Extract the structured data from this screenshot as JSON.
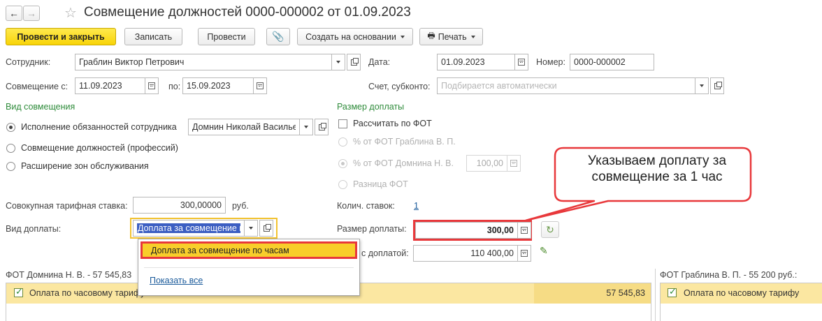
{
  "header": {
    "title": "Совмещение должностей 0000-000002 от 01.09.2023"
  },
  "toolbar": {
    "post_close": "Провести и закрыть",
    "save": "Записать",
    "post": "Провести",
    "create_based": "Создать на основании",
    "print": "Печать"
  },
  "form": {
    "employee_label": "Сотрудник:",
    "employee_value": "Граблин Виктор Петрович",
    "date_label": "Дата:",
    "date_value": "01.09.2023",
    "number_label": "Номер:",
    "number_value": "0000-000002",
    "from_label": "Совмещение с:",
    "from_value": "11.09.2023",
    "to_label": "по:",
    "to_value": "15.09.2023",
    "account_label": "Счет, субконто:",
    "account_placeholder": "Подбирается автоматически"
  },
  "combination": {
    "title": "Вид совмещения",
    "options": [
      "Исполнение обязанностей сотрудника",
      "Совмещение должностей (профессий)",
      "Расширение зон обслуживания"
    ],
    "selected": "Исполнение обязанностей сотрудника",
    "employee_value": "Домнин Николай Васильевич"
  },
  "payment": {
    "title": "Размер доплаты",
    "calc_label": "Рассчитать по ФОТ",
    "opt1": "% от ФОТ Граблина В. П.",
    "opt2": "% от ФОТ Домнина Н. В.",
    "opt2_value": "100,00",
    "opt3": "Разница ФОТ",
    "rates_label": "Колич. ставок:",
    "rates_value": "1",
    "amount_label": "Размер доплаты:",
    "amount_value": "300,00",
    "with_label": "с доплатой:",
    "with_value": "110 400,00"
  },
  "tariff": {
    "label": "Совокупная тарифная ставка:",
    "value": "300,00000",
    "unit": "руб."
  },
  "kind": {
    "label": "Вид доплаты:",
    "value": "Доплата за совмещение по часам"
  },
  "dropdown": {
    "item": "Доплата за совмещение по часам",
    "show_all": "Показать все"
  },
  "callout": {
    "text": "Указываем доплату за совмещение за 1 час"
  },
  "tables": {
    "left_title": "ФОТ Домнина Н. В. - 57 545,83",
    "left_row": "Оплата по часовому тарифу",
    "left_amount": "57 545,83",
    "right_title": "ФОТ Граблина В. П. - 55 200 руб.:",
    "right_row": "Оплата по часовому тарифу"
  },
  "colors": {
    "primary_button": "#f8d408",
    "highlight": "#e8383b",
    "green_label": "#2e8b3a"
  }
}
